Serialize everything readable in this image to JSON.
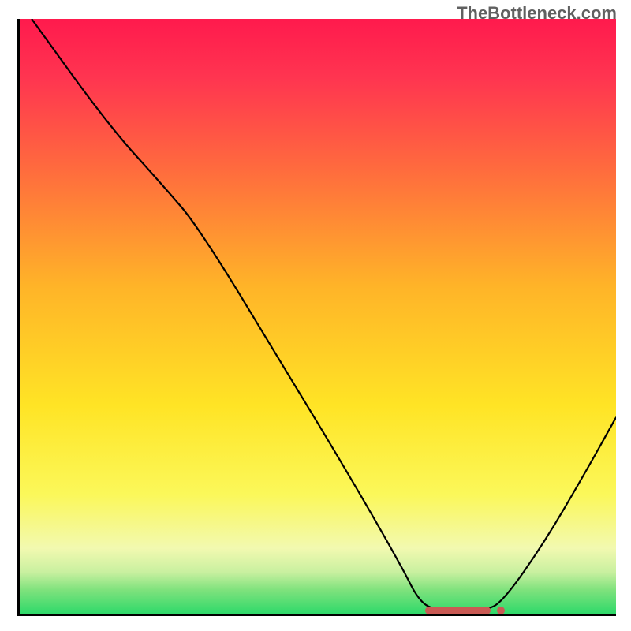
{
  "watermark": "TheBottleneck.com",
  "chart_data": {
    "type": "line",
    "title": "",
    "xlabel": "",
    "ylabel": "",
    "xlim": [
      0,
      100
    ],
    "ylim": [
      0,
      100
    ],
    "gradient_stops": [
      {
        "offset": 0,
        "color": "#ff1a4d"
      },
      {
        "offset": 10,
        "color": "#ff3550"
      },
      {
        "offset": 25,
        "color": "#ff6a3e"
      },
      {
        "offset": 45,
        "color": "#ffb428"
      },
      {
        "offset": 65,
        "color": "#ffe425"
      },
      {
        "offset": 80,
        "color": "#fbf85a"
      },
      {
        "offset": 89,
        "color": "#f2f9b0"
      },
      {
        "offset": 93,
        "color": "#c9f0a0"
      },
      {
        "offset": 96,
        "color": "#7fe27d"
      },
      {
        "offset": 100,
        "color": "#2fd96a"
      }
    ],
    "series": [
      {
        "name": "bottleneck-curve",
        "points": [
          {
            "x": 2,
            "y": 100
          },
          {
            "x": 15,
            "y": 82
          },
          {
            "x": 24,
            "y": 72
          },
          {
            "x": 30,
            "y": 65
          },
          {
            "x": 44,
            "y": 42
          },
          {
            "x": 56,
            "y": 22
          },
          {
            "x": 64,
            "y": 8
          },
          {
            "x": 67,
            "y": 2
          },
          {
            "x": 70,
            "y": 0.5
          },
          {
            "x": 78,
            "y": 0.5
          },
          {
            "x": 81,
            "y": 2
          },
          {
            "x": 88,
            "y": 12
          },
          {
            "x": 95,
            "y": 24
          },
          {
            "x": 100,
            "y": 33
          }
        ]
      }
    ],
    "trough_marker": {
      "x_start": 68,
      "x_end": 79,
      "y": 0.5
    }
  }
}
